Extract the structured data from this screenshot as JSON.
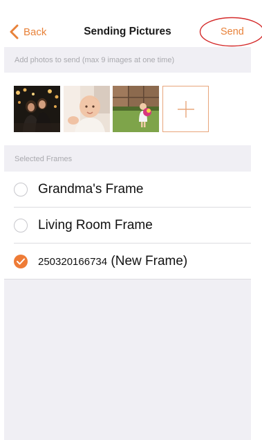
{
  "navbar": {
    "back_label": "Back",
    "title": "Sending Pictures",
    "send_label": "Send",
    "accent_color": "#e8823a",
    "annotation_color": "#d42a2a"
  },
  "photos_section": {
    "header": "Add photos to send (max 9 images at one time)",
    "thumbnails": [
      {
        "icon": "photo-couple-night"
      },
      {
        "icon": "photo-baby"
      },
      {
        "icon": "photo-child-garden"
      }
    ],
    "add_icon": "plus-icon"
  },
  "frames_section": {
    "header": "Selected Frames",
    "frames": [
      {
        "label": "Grandma's Frame",
        "selected": false
      },
      {
        "label": "Living Room Frame",
        "selected": false
      },
      {
        "id": "250320166734",
        "suffix": "(New Frame)",
        "selected": true
      }
    ],
    "check_color": "#ee7b36"
  }
}
